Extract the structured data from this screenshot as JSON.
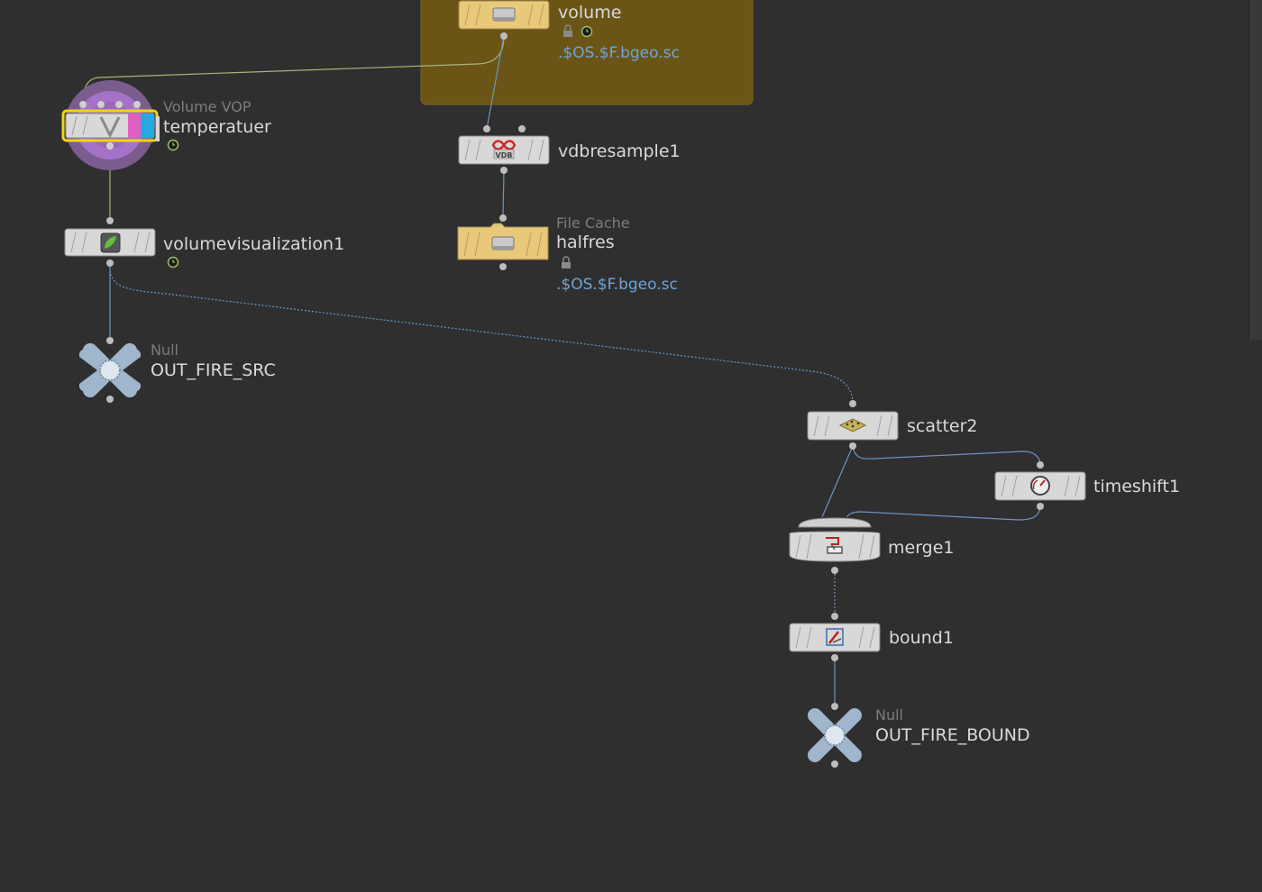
{
  "network_box": {
    "color": "#6b5516"
  },
  "nodes": {
    "volume": {
      "name": "volume",
      "path": ".$OS.$F.bgeo.sc",
      "icon": "disk-icon"
    },
    "temperatuer": {
      "type": "Volume VOP",
      "name": "temperatuer",
      "icon": "vop-v-icon"
    },
    "vdbresample1": {
      "name": "vdbresample1",
      "icon": "vdb-icon"
    },
    "halfres": {
      "type": "File Cache",
      "name": "halfres",
      "path": ".$OS.$F.bgeo.sc",
      "icon": "disk-icon"
    },
    "volumevisualization1": {
      "name": "volumevisualization1",
      "icon": "volume-vis-icon"
    },
    "out_fire_src": {
      "type": "Null",
      "name": "OUT_FIRE_SRC"
    },
    "scatter2": {
      "name": "scatter2",
      "icon": "scatter-icon"
    },
    "timeshift1": {
      "name": "timeshift1",
      "icon": "clock-icon"
    },
    "merge1": {
      "name": "merge1",
      "icon": "merge-icon"
    },
    "bound1": {
      "name": "bound1",
      "icon": "bound-icon"
    },
    "out_fire_bound": {
      "type": "Null",
      "name": "OUT_FIRE_BOUND"
    }
  },
  "colors": {
    "node_body": "#d8d8d8",
    "cache_body": "#e8c97a",
    "selected_outline": "#f2d416",
    "wire_blue": "#6f93bf",
    "wire_green": "#a8b57e",
    "null_color": "#9fb6cc",
    "path_text": "#6ea5d8"
  }
}
